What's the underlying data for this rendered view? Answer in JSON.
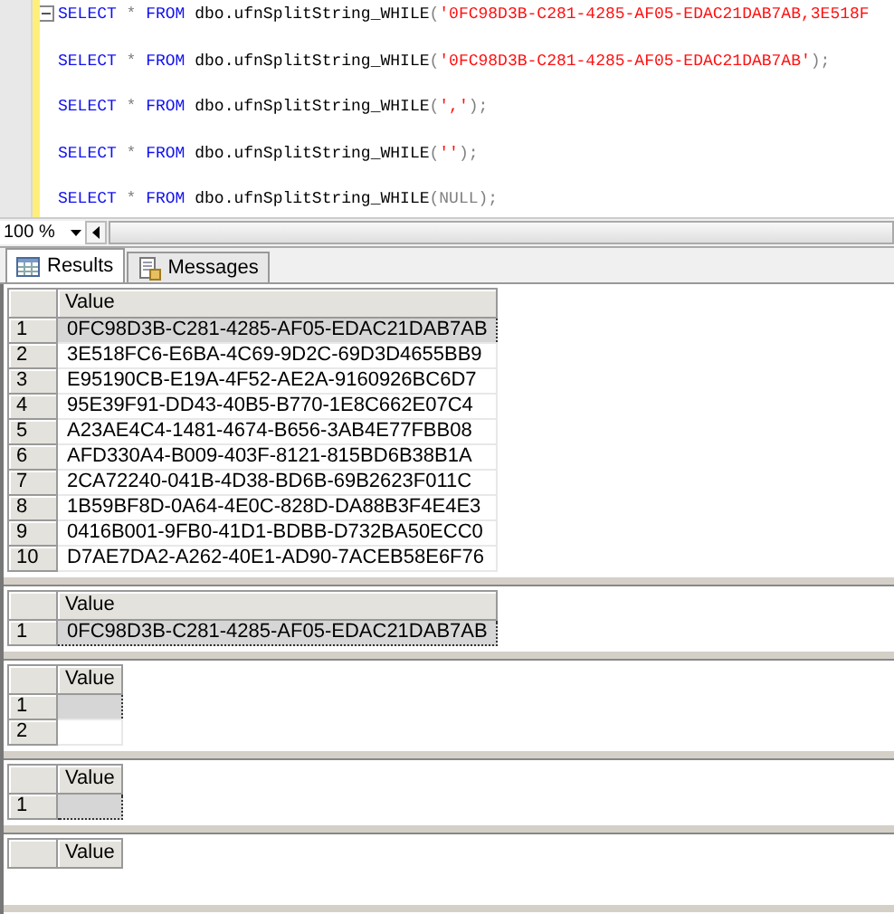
{
  "editor": {
    "lines": [
      [
        {
          "kind": "keyword",
          "text": "SELECT"
        },
        {
          "kind": "operator",
          "text": " * "
        },
        {
          "kind": "keyword",
          "text": "FROM"
        },
        {
          "kind": "plain",
          "text": " dbo.ufnSplitString_WHILE"
        },
        {
          "kind": "operator",
          "text": "("
        },
        {
          "kind": "string",
          "text": "'0FC98D3B-C281-4285-AF05-EDAC21DAB7AB,3E518F"
        }
      ],
      [
        {
          "kind": "keyword",
          "text": "SELECT"
        },
        {
          "kind": "operator",
          "text": " * "
        },
        {
          "kind": "keyword",
          "text": "FROM"
        },
        {
          "kind": "plain",
          "text": " dbo.ufnSplitString_WHILE"
        },
        {
          "kind": "operator",
          "text": "("
        },
        {
          "kind": "string",
          "text": "'0FC98D3B-C281-4285-AF05-EDAC21DAB7AB'"
        },
        {
          "kind": "operator",
          "text": ");"
        }
      ],
      [
        {
          "kind": "keyword",
          "text": "SELECT"
        },
        {
          "kind": "operator",
          "text": " * "
        },
        {
          "kind": "keyword",
          "text": "FROM"
        },
        {
          "kind": "plain",
          "text": " dbo.ufnSplitString_WHILE"
        },
        {
          "kind": "operator",
          "text": "("
        },
        {
          "kind": "string",
          "text": "','"
        },
        {
          "kind": "operator",
          "text": ");"
        }
      ],
      [
        {
          "kind": "keyword",
          "text": "SELECT"
        },
        {
          "kind": "operator",
          "text": " * "
        },
        {
          "kind": "keyword",
          "text": "FROM"
        },
        {
          "kind": "plain",
          "text": " dbo.ufnSplitString_WHILE"
        },
        {
          "kind": "operator",
          "text": "("
        },
        {
          "kind": "string",
          "text": "''"
        },
        {
          "kind": "operator",
          "text": ");"
        }
      ],
      [
        {
          "kind": "keyword",
          "text": "SELECT"
        },
        {
          "kind": "operator",
          "text": " * "
        },
        {
          "kind": "keyword",
          "text": "FROM"
        },
        {
          "kind": "plain",
          "text": " dbo.ufnSplitString_WHILE"
        },
        {
          "kind": "operator",
          "text": "(NULL);"
        }
      ]
    ]
  },
  "zoom": {
    "value": "100 %"
  },
  "tabs": [
    {
      "label": "Results",
      "selected": true
    },
    {
      "label": "Messages",
      "selected": false
    }
  ],
  "result_sets": [
    {
      "column": "Value",
      "rows": [
        {
          "number": "1",
          "value": "0FC98D3B-C281-4285-AF05-EDAC21DAB7AB",
          "selected": true
        },
        {
          "number": "2",
          "value": "3E518FC6-E6BA-4C69-9D2C-69D3D4655BB9",
          "selected": false
        },
        {
          "number": "3",
          "value": "E95190CB-E19A-4F52-AE2A-9160926BC6D7",
          "selected": false
        },
        {
          "number": "4",
          "value": "95E39F91-DD43-40B5-B770-1E8C662E07C4",
          "selected": false
        },
        {
          "number": "5",
          "value": "A23AE4C4-1481-4674-B656-3AB4E77FBB08",
          "selected": false
        },
        {
          "number": "6",
          "value": "AFD330A4-B009-403F-8121-815BD6B38B1A",
          "selected": false
        },
        {
          "number": "7",
          "value": "2CA72240-041B-4D38-BD6B-69B2623F011C",
          "selected": false
        },
        {
          "number": "8",
          "value": "1B59BF8D-0A64-4E0C-828D-DA88B3F4E4E3",
          "selected": false
        },
        {
          "number": "9",
          "value": "0416B001-9FB0-41D1-BDBB-D732BA50ECC0",
          "selected": false
        },
        {
          "number": "10",
          "value": "D7AE7DA2-A262-40E1-AD90-7ACEB58E6F76",
          "selected": false
        }
      ]
    },
    {
      "column": "Value",
      "rows": [
        {
          "number": "1",
          "value": "0FC98D3B-C281-4285-AF05-EDAC21DAB7AB",
          "selected": true
        }
      ]
    },
    {
      "column": "Value",
      "rows": [
        {
          "number": "1",
          "selected": true
        },
        {
          "number": "2",
          "selected": false
        }
      ]
    },
    {
      "column": "Value",
      "rows": [
        {
          "number": "1",
          "selected": true
        }
      ]
    },
    {
      "column": "Value"
    }
  ]
}
